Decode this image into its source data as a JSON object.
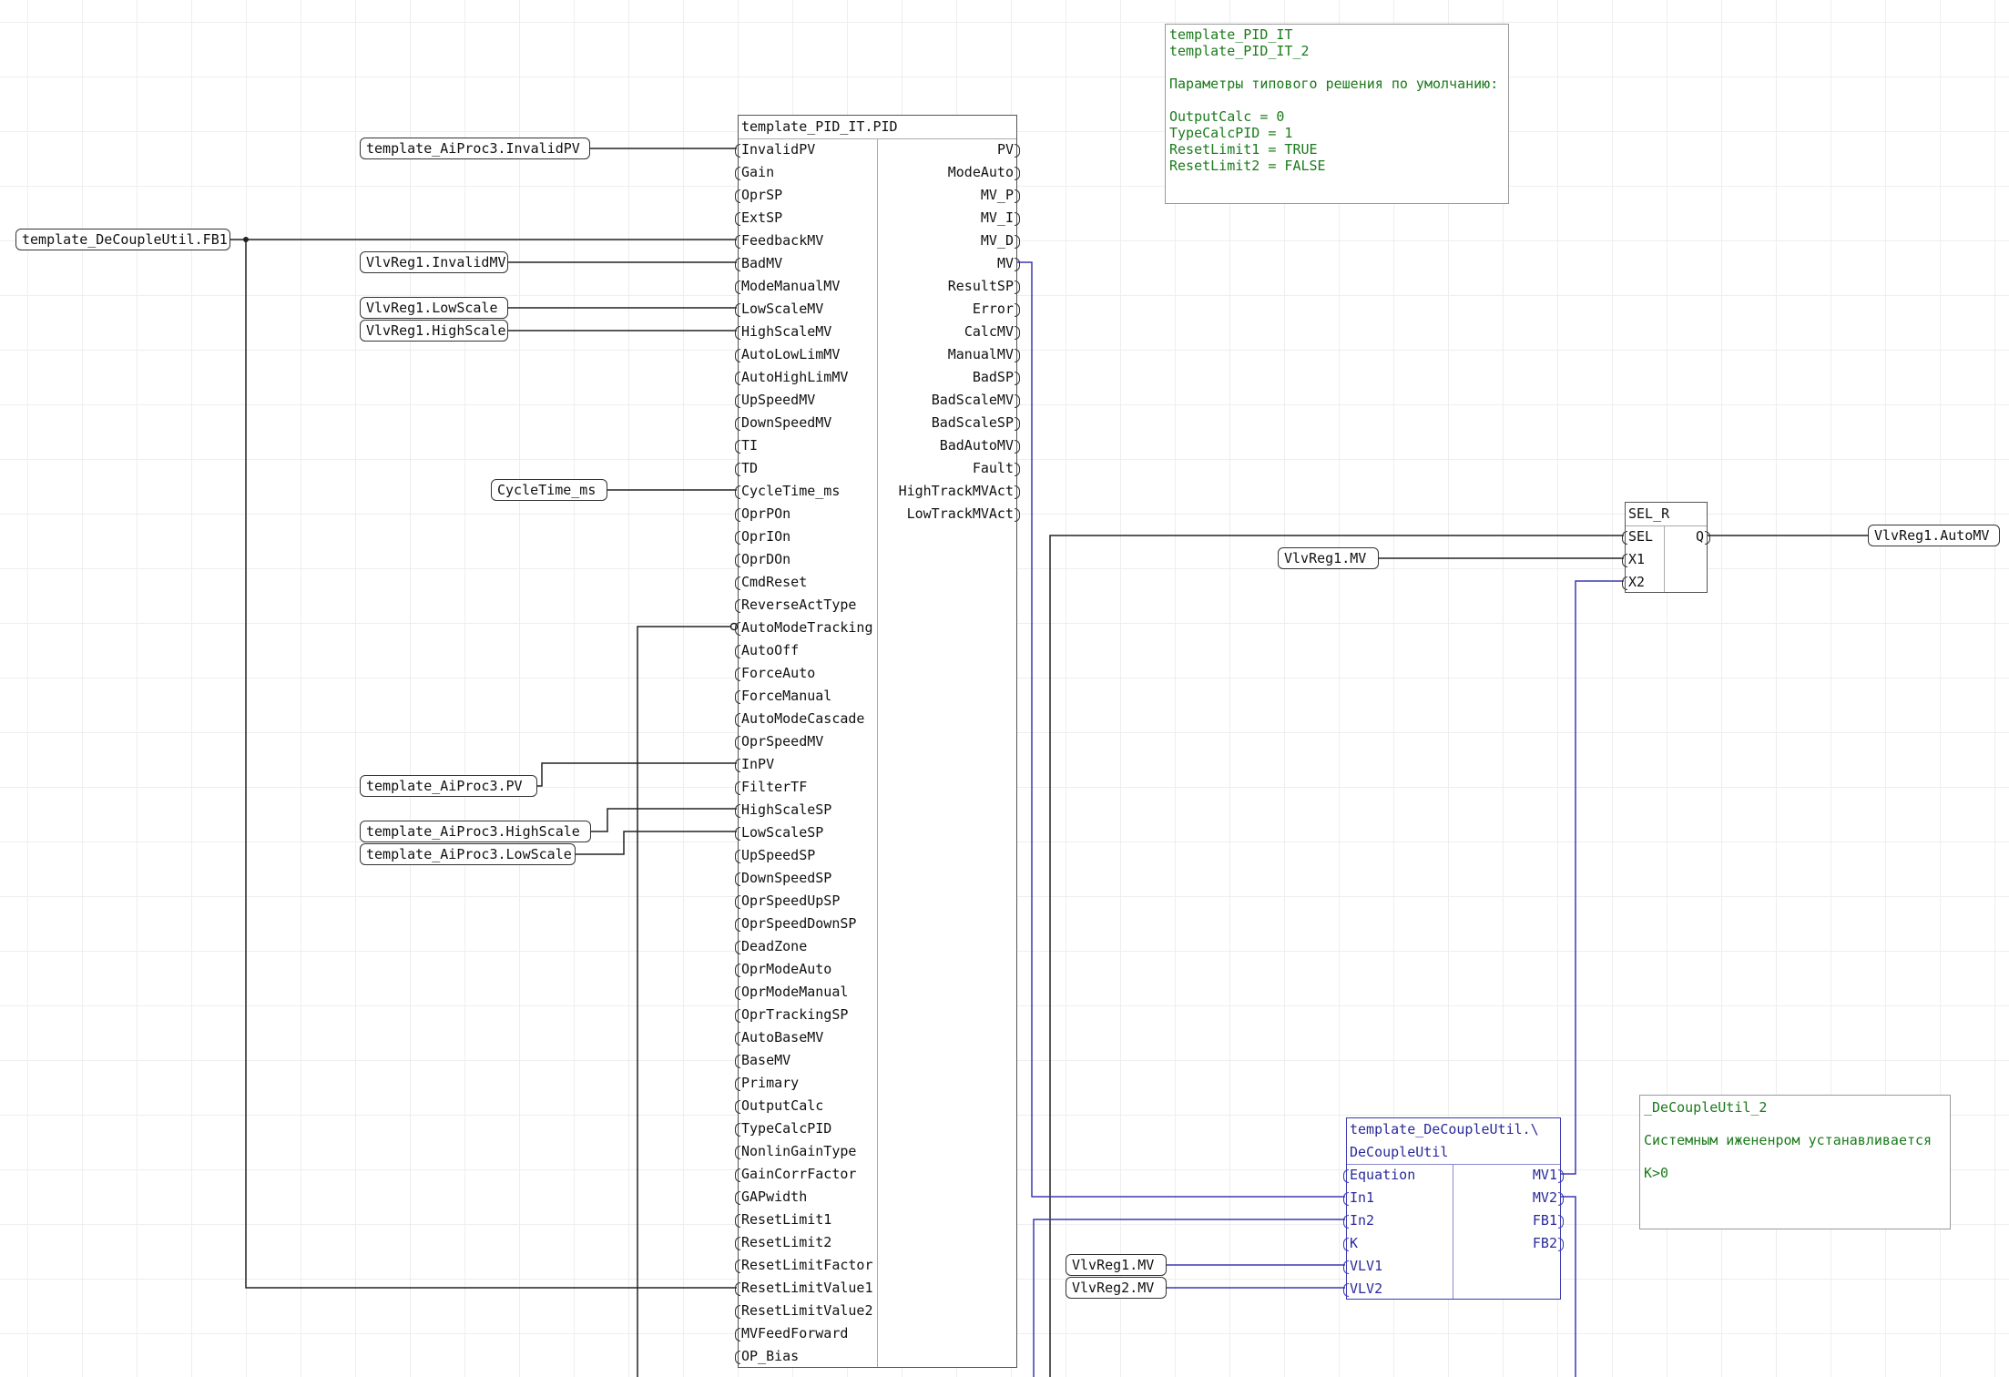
{
  "colors": {
    "wire": "#222222",
    "wire_blue": "#3a3ab0",
    "comment_text": "#1b7a1b",
    "block_border": "#555555"
  },
  "pid_block": {
    "title": "template_PID_IT.PID",
    "inputs": [
      "InvalidPV",
      "Gain",
      "OprSP",
      "ExtSP",
      "FeedbackMV",
      "BadMV",
      "ModeManualMV",
      "LowScaleMV",
      "HighScaleMV",
      "AutoLowLimMV",
      "AutoHighLimMV",
      "UpSpeedMV",
      "DownSpeedMV",
      "TI",
      "TD",
      "CycleTime_ms",
      "OprPOn",
      "OprIOn",
      "OprDOn",
      "CmdReset",
      "ReverseActType",
      "AutoModeTracking",
      "AutoOff",
      "ForceAuto",
      "ForceManual",
      "AutoModeCascade",
      "OprSpeedMV",
      "InPV",
      "FilterTF",
      "HighScaleSP",
      "LowScaleSP",
      "UpSpeedSP",
      "DownSpeedSP",
      "OprSpeedUpSP",
      "OprSpeedDownSP",
      "DeadZone",
      "OprModeAuto",
      "OprModeManual",
      "OprTrackingSP",
      "AutoBaseMV",
      "BaseMV",
      "Primary",
      "OutputCalc",
      "TypeCalcPID",
      "NonlinGainType",
      "GainCorrFactor",
      "GAPwidth",
      "ResetLimit1",
      "ResetLimit2",
      "ResetLimitFactor",
      "ResetLimitValue1",
      "ResetLimitValue2",
      "MVFeedForward",
      "OP_Bias"
    ],
    "outputs": [
      "PV",
      "ModeAuto",
      "MV_P",
      "MV_I",
      "MV_D",
      "MV",
      "ResultSP",
      "Error",
      "CalcMV",
      "ManualMV",
      "BadSP",
      "BadScaleMV",
      "BadScaleSP",
      "BadAutoMV",
      "Fault",
      "HighTrackMVAct",
      "LowTrackMVAct"
    ]
  },
  "sel_block": {
    "title": "SEL_R",
    "inputs": [
      "SEL",
      "X1",
      "X2"
    ],
    "outputs": [
      "Q"
    ]
  },
  "decouple_block": {
    "title_line1": "template_DeCoupleUtil.\\",
    "title_line2": "DeCoupleUtil",
    "inputs": [
      "Equation",
      "In1",
      "In2",
      "K",
      "VLV1",
      "VLV2"
    ],
    "outputs": [
      "MV1",
      "MV2",
      "FB1",
      "FB2"
    ]
  },
  "variables": {
    "invalid_pv": "template_AiProc3.InvalidPV",
    "decouple_fb1": "template_DeCoupleUtil.FB1",
    "invalid_mv": "VlvReg1.InvalidMV",
    "low_scale": "VlvReg1.LowScale",
    "high_scale": "VlvReg1.HighScale",
    "cycle_time": "CycleTime_ms",
    "ai_pv": "template_AiProc3.PV",
    "ai_high_scale": "template_AiProc3.HighScale",
    "ai_low_scale": "template_AiProc3.LowScale",
    "sel_x1": "VlvReg1.MV",
    "sel_q": "VlvReg1.AutoMV",
    "vlv1": "VlvReg1.MV",
    "vlv2": "VlvReg2.MV"
  },
  "comments": {
    "pid_defaults": "template_PID_IT\ntemplate_PID_IT_2\n\nПараметры типового решения по умолчанию:\n\nOutputCalc = 0\nTypeCalcPID = 1\nResetLimit1 = TRUE\nResetLimit2 = FALSE",
    "decouple_note": "_DeCoupleUtil_2\n\nСистемным ижененром устанавливается\n\nK>0"
  }
}
